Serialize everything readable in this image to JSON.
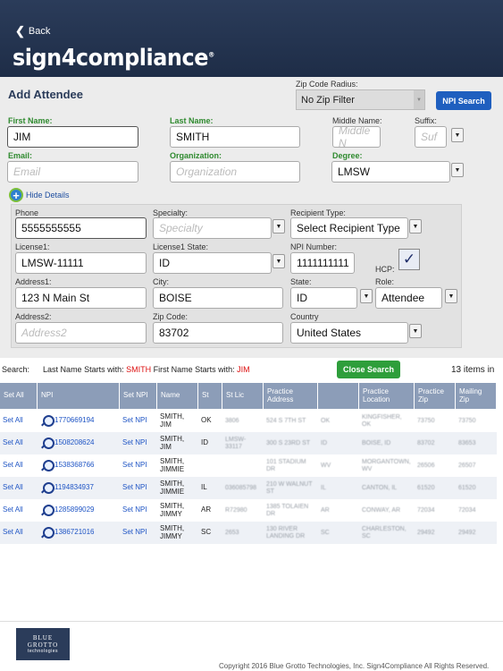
{
  "header": {
    "back_label": "Back",
    "logo_text": "sign4compliance",
    "logo_mark": "®"
  },
  "form": {
    "title": "Add Attendee",
    "zip_radius_label": "Zip Code Radius:",
    "zip_radius_value": "No Zip Filter",
    "npi_search_label": "NPI Search",
    "first_name_label": "First Name:",
    "first_name_value": "JIM",
    "last_name_label": "Last Name:",
    "last_name_value": "SMITH",
    "middle_name_label": "Middle Name:",
    "middle_name_placeholder": "Middle N",
    "suffix_label": "Suffix:",
    "suffix_placeholder": "Suf",
    "email_label": "Email:",
    "email_placeholder": "Email",
    "organization_label": "Organization:",
    "organization_placeholder": "Organization",
    "degree_label": "Degree:",
    "degree_value": "LMSW",
    "hide_details_label": "Hide Details"
  },
  "details": {
    "phone_label": "Phone",
    "phone_value": "5555555555",
    "specialty_label": "Specialty:",
    "specialty_placeholder": "Specialty",
    "recipient_type_label": "Recipient Type:",
    "recipient_type_value": "Select Recipient Type",
    "license1_label": "License1:",
    "license1_value": "LMSW-11111",
    "license1_state_label": "License1 State:",
    "license1_state_value": "ID",
    "npi_number_label": "NPI Number:",
    "npi_number_value": "1111111111",
    "hcp_label": "HCP:",
    "hcp_checked": "✓",
    "address1_label": "Address1:",
    "address1_value": "123 N Main St",
    "city_label": "City:",
    "city_value": "BOISE",
    "state_label": "State:",
    "state_value": "ID",
    "role_label": "Role:",
    "role_value": "Attendee",
    "address2_label": "Address2:",
    "address2_placeholder": "Address2",
    "zip_label": "Zip Code:",
    "zip_value": "83702",
    "country_label": "Country",
    "country_value": "United States"
  },
  "search": {
    "prefix": "Search:",
    "last_name_text": "Last Name Starts with:",
    "last_name_value": "SMITH",
    "first_name_text": "First Name Starts with:",
    "first_name_value": "JIM",
    "close_label": "Close Search",
    "count_text": "13 items in"
  },
  "table": {
    "columns": [
      "Set All",
      "NPI",
      "Set NPI",
      "Name",
      "St",
      "St Lic",
      "Practice Address",
      "",
      "Practice Location",
      "Practice Zip",
      "Mailing Zip"
    ],
    "rows": [
      {
        "set_all": "Set All",
        "npi": "1770669194",
        "set_npi": "Set NPI",
        "name": "SMITH, JIM",
        "st": "OK",
        "st_lic": "3806",
        "address": "524 S 7TH ST",
        "state2": "OK",
        "location": "KINGFISHER, OK",
        "pzip": "73750",
        "mzip": "73750"
      },
      {
        "set_all": "Set All",
        "npi": "1508208624",
        "set_npi": "Set NPI",
        "name": "SMITH, JIM",
        "st": "ID",
        "st_lic": "LMSW-33117",
        "address": "300 S 23RD ST",
        "state2": "ID",
        "location": "BOISE, ID",
        "pzip": "83702",
        "mzip": "83653"
      },
      {
        "set_all": "Set All",
        "npi": "1538368766",
        "set_npi": "Set NPI",
        "name": "SMITH, JIMMIE",
        "st": "",
        "st_lic": "",
        "address": "101 STADIUM DR",
        "state2": "WV",
        "location": "MORGANTOWN, WV",
        "pzip": "26506",
        "mzip": "26507"
      },
      {
        "set_all": "Set All",
        "npi": "1194834937",
        "set_npi": "Set NPI",
        "name": "SMITH, JIMMIE",
        "st": "IL",
        "st_lic": "036085798",
        "address": "210 W WALNUT ST",
        "state2": "IL",
        "location": "CANTON, IL",
        "pzip": "61520",
        "mzip": "61520"
      },
      {
        "set_all": "Set All",
        "npi": "1285899029",
        "set_npi": "Set NPI",
        "name": "SMITH, JIMMY",
        "st": "AR",
        "st_lic": "R72980",
        "address": "1385 TOLAIEN DR",
        "state2": "AR",
        "location": "CONWAY, AR",
        "pzip": "72034",
        "mzip": "72034"
      },
      {
        "set_all": "Set All",
        "npi": "1386721016",
        "set_npi": "Set NPI",
        "name": "SMITH, JIMMY",
        "st": "SC",
        "st_lic": "2653",
        "address": "130 RIVER LANDING DR",
        "state2": "SC",
        "location": "CHARLESTON, SC",
        "pzip": "29492",
        "mzip": "29492"
      }
    ]
  },
  "footer": {
    "logo_line1": "BLUE",
    "logo_line2": "GROTTO",
    "logo_line3": "technologies",
    "copyright": "Copyright 2016 Blue Grotto Technologies, Inc.  Sign4Compliance All Rights Reserved."
  },
  "colors": {
    "header_bg": "#1e2d47",
    "accent_green": "#2f8a2f",
    "npi_button": "#1f5fbf",
    "close_button": "#2e9e3b",
    "table_header": "#8c9db8",
    "highlight_red": "#dd1111"
  }
}
